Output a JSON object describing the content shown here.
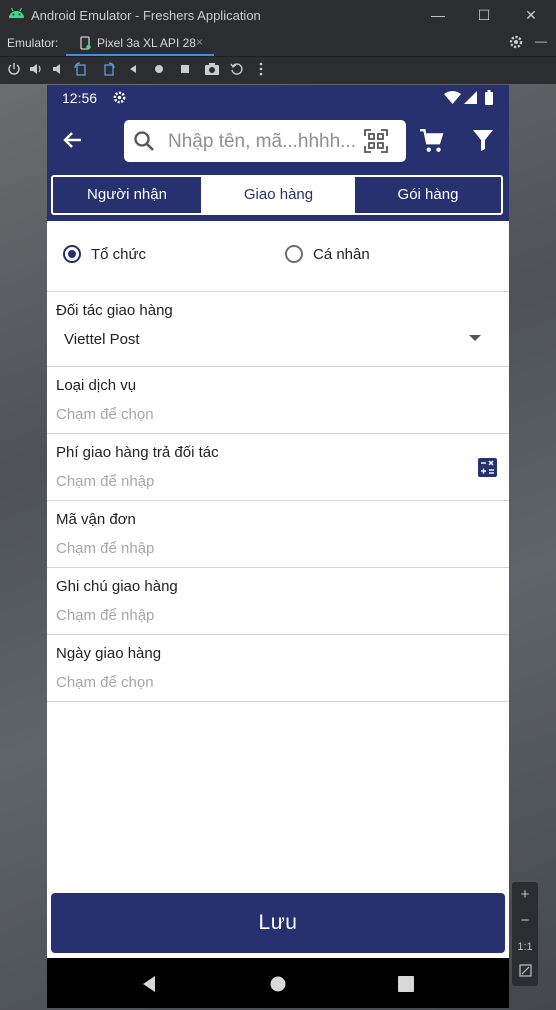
{
  "window": {
    "title": "Android Emulator - Freshers Application",
    "minimize": "—",
    "maximize": "☐",
    "close": "✕"
  },
  "emulator": {
    "label": "Emulator:",
    "device_tab": "Pixel 3a XL API 28",
    "tab_close": "×",
    "menu_dash": "—"
  },
  "side_tools": {
    "zoom_in": "+",
    "zoom_out": "−",
    "ratio": "1:1"
  },
  "status_bar": {
    "time": "12:56"
  },
  "search": {
    "placeholder": "Nhập tên, mã...hhhh..."
  },
  "tabs": [
    {
      "label": "Người nhận",
      "active": false
    },
    {
      "label": "Giao hàng",
      "active": true
    },
    {
      "label": "Gói hàng",
      "active": false
    }
  ],
  "recipient_type": {
    "options": [
      {
        "label": "Tổ chức",
        "selected": true
      },
      {
        "label": "Cá nhân",
        "selected": false
      }
    ]
  },
  "fields": {
    "partner": {
      "label": "Đối tác giao hàng",
      "value": "Viettel Post"
    },
    "service": {
      "label": "Loại dịch vụ",
      "placeholder": "Chạm để chọn"
    },
    "fee": {
      "label": "Phí giao hàng trả đối tác",
      "placeholder": "Chạm để nhập"
    },
    "tracking": {
      "label": "Mã vận đơn",
      "placeholder": "Chạm để nhập"
    },
    "note": {
      "label": "Ghi chú giao hàng",
      "placeholder": "Chạm để nhập"
    },
    "date": {
      "label": "Ngày giao hàng",
      "placeholder": "Chạm để chọn"
    }
  },
  "save_button": "Lưu",
  "colors": {
    "primary": "#283170",
    "emulator_chrome": "#2b2d30",
    "accent_tab": "#3d8fe6"
  }
}
